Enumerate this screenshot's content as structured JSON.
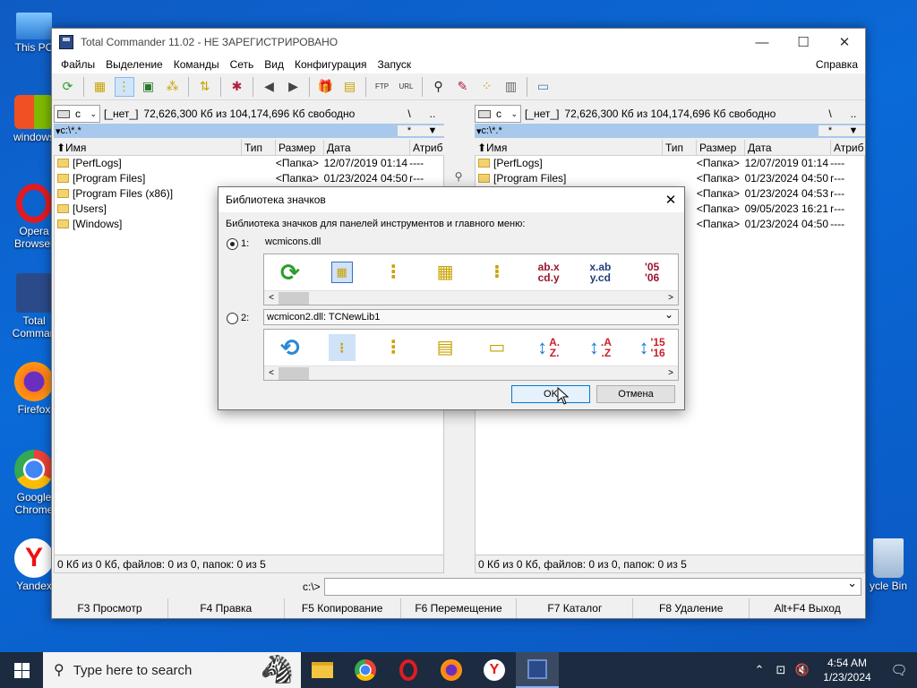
{
  "desktop": {
    "icons": [
      {
        "label": "This PC",
        "icon": "this-pc-icon"
      },
      {
        "label": "windows",
        "icon": "windows-folder-icon"
      },
      {
        "label": "Opera\nBrowser",
        "icon": "opera-icon"
      },
      {
        "label": "Total\nComman",
        "icon": "total-commander-icon"
      },
      {
        "label": "Firefox",
        "icon": "firefox-icon"
      },
      {
        "label": "Google\nChrome",
        "icon": "chrome-icon"
      },
      {
        "label": "Yandex",
        "icon": "yandex-icon"
      },
      {
        "label": "ycle Bin",
        "icon": "recycle-bin-icon"
      }
    ]
  },
  "window": {
    "title": "Total Commander 11.02 - НЕ ЗАРЕГИСТРИРОВАНО",
    "controls": {
      "minimize": "—",
      "maximize": "☐",
      "close": "✕"
    }
  },
  "menu": [
    "Файлы",
    "Выделение",
    "Команды",
    "Сеть",
    "Вид",
    "Конфигурация",
    "Запуск"
  ],
  "menu_help": "Справка",
  "toolbar_icons": [
    "refresh-icon",
    "brief-view-icon",
    "tree-view-icon",
    "thumbnails-icon",
    "compare-icon",
    "sync-icon",
    "unpack-icon",
    "back-icon",
    "forward-icon",
    "pack-icon",
    "unpack-all-icon",
    "ftp-icon",
    "url-icon",
    "find-icon",
    "rename-icon",
    "tree-icon",
    "multi-rename-icon",
    "notepad-icon"
  ],
  "left_panel": {
    "drive": "c",
    "volume": "[_нет_]",
    "space": "72,626,300 Кб из 104,174,696 Кб свободно",
    "root_btn": "\\",
    "up_btn": "..",
    "path": "c:\\*.*",
    "path_star": "*",
    "path_arrow": "▼",
    "headers": {
      "name": "⬆Имя",
      "ext": "Тип",
      "size": "Размер",
      "date": "Дата",
      "attr": "Атриб"
    },
    "rows": [
      {
        "name": "[PerfLogs]",
        "size": "<Папка>",
        "date": "12/07/2019 01:14",
        "attr": "----"
      },
      {
        "name": "[Program Files]",
        "size": "<Папка>",
        "date": "01/23/2024 04:50",
        "attr": "r---"
      },
      {
        "name": "[Program Files (x86)]",
        "size": "",
        "date": "",
        "attr": ""
      },
      {
        "name": "[Users]",
        "size": "",
        "date": "",
        "attr": ""
      },
      {
        "name": "[Windows]",
        "size": "",
        "date": "",
        "attr": ""
      }
    ],
    "status": "0 Кб из 0 Кб, файлов: 0 из 0, папок: 0 из 5"
  },
  "right_panel": {
    "drive": "c",
    "volume": "[_нет_]",
    "space": "72,626,300 Кб из 104,174,696 Кб свободно",
    "root_btn": "\\",
    "up_btn": "..",
    "path": "c:\\*.*",
    "path_star": "*",
    "path_arrow": "▼",
    "headers": {
      "name": "⬆Имя",
      "ext": "Тип",
      "size": "Размер",
      "date": "Дата",
      "attr": "Атриб"
    },
    "rows": [
      {
        "name": "[PerfLogs]",
        "size": "<Папка>",
        "date": "12/07/2019 01:14",
        "attr": "----"
      },
      {
        "name": "[Program Files]",
        "size": "<Папка>",
        "date": "01/23/2024 04:50",
        "attr": "r---"
      },
      {
        "name": "",
        "size": "<Папка>",
        "date": "01/23/2024 04:53",
        "attr": "r---"
      },
      {
        "name": "",
        "size": "<Папка>",
        "date": "09/05/2023 16:21",
        "attr": "r---"
      },
      {
        "name": "",
        "size": "<Папка>",
        "date": "01/23/2024 04:50",
        "attr": "----"
      }
    ],
    "status": "0 Кб из 0 Кб, файлов: 0 из 0, папок: 0 из 5"
  },
  "command_line": {
    "prompt": "c:\\>",
    "value": ""
  },
  "fkeys": [
    "F3 Просмотр",
    "F4 Правка",
    "F5 Копирование",
    "F6 Перемещение",
    "F7 Каталог",
    "F8 Удаление",
    "Alt+F4 Выход"
  ],
  "dialog": {
    "title": "Библиотека значков",
    "close": "✕",
    "label": "Библиотека значков для панелей инструментов и главного меню:",
    "option1": {
      "num": "1:",
      "file": "wcmicons.dll",
      "selected": true,
      "icons": [
        {
          "name": "refresh-icon",
          "text": ""
        },
        {
          "name": "brief-view-icon",
          "text": ""
        },
        {
          "name": "tree-folder-icon",
          "text": ""
        },
        {
          "name": "thumbnails-icon",
          "text": ""
        },
        {
          "name": "single-column-icon",
          "text": ""
        },
        {
          "name": "sort-by-ext-icon",
          "text": "ab.x\ncd.y"
        },
        {
          "name": "sort-by-name-icon",
          "text": "x.ab\ny.cd"
        },
        {
          "name": "sort-by-date-icon",
          "text": "'05\n'06"
        }
      ]
    },
    "option2": {
      "num": "2:",
      "file": "wcmicon2.dll: TCNewLib1",
      "selected": false,
      "icons": [
        {
          "name": "refresh-icon",
          "text": ""
        },
        {
          "name": "brief-view-icon",
          "text": ""
        },
        {
          "name": "tree-folder-icon",
          "text": ""
        },
        {
          "name": "thumbnails-icon",
          "text": ""
        },
        {
          "name": "single-column-icon",
          "text": ""
        },
        {
          "name": "sort-asc-icon",
          "text": "A.\nZ."
        },
        {
          "name": "sort-ext-asc-icon",
          "text": ".A\n.Z"
        },
        {
          "name": "sort-date-asc-icon",
          "text": "'15\n'16"
        }
      ]
    },
    "ok": "OK",
    "cancel": "Отмена"
  },
  "taskbar": {
    "search_placeholder": "Type here to search",
    "apps": [
      "file-explorer-icon",
      "chrome-icon",
      "opera-icon",
      "firefox-icon",
      "yandex-icon",
      "total-commander-icon"
    ],
    "time": "4:54 AM",
    "date": "1/23/2024"
  },
  "colors": {
    "path_bar": "#a8c8ec",
    "desktop": "#0a6ad8",
    "taskbar": "#1c2b3f",
    "ok_border": "#0078d7"
  }
}
